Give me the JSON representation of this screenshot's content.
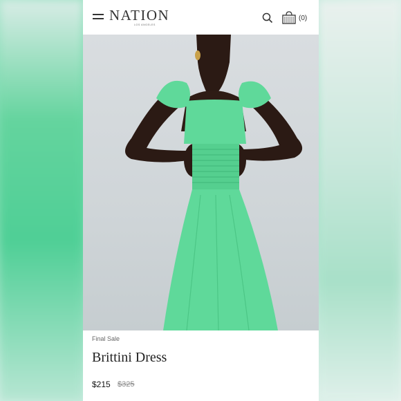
{
  "header": {
    "logo_text": "NATION",
    "logo_sub": "LOS ANGELES",
    "cart_count": "(0)"
  },
  "icons": {
    "menu": "menu-icon",
    "search": "search-icon",
    "cart": "shopping-bag-icon"
  },
  "carousel": {
    "total_slides": 7,
    "active_index": 0
  },
  "product": {
    "sale_label": "Final Sale",
    "name": "Brittini Dress",
    "price": "$215",
    "original_price": "$325",
    "dress_color": "#5fd99a"
  }
}
